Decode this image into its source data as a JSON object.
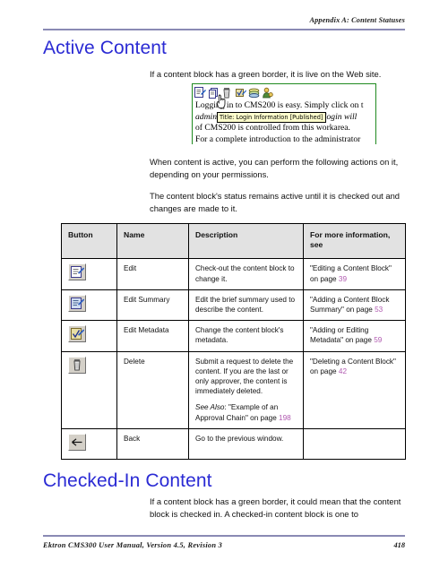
{
  "header": {
    "running_head": "Appendix A: Content Statuses"
  },
  "sections": [
    {
      "heading": "Active Content",
      "intro": "If a content block has a green border, it is live on the Web site."
    },
    {
      "heading": "Checked-In Content",
      "body": "If a content block has a green border, it could mean that the content block is checked in. A checked-in content block is one to"
    }
  ],
  "screenshot": {
    "border_color": "#1f8a1f",
    "toolbar_icons": [
      "edit-icon",
      "edit-summary-icon",
      "delete-icon",
      "edit-metadata-icon",
      "collection-icon",
      "permissions-icon"
    ],
    "tooltip": "Title: Login Information [Published]",
    "lines": [
      "Logging in to CMS200 is easy. Simply click on t",
      "admin and the password admin. This login will",
      "of CMS200 is controlled from this workarea.",
      "For a complete introduction to the administrator"
    ]
  },
  "paragraphs": {
    "when_active": "When content is active, you can perform the following actions on it, depending on your permissions.",
    "status_remains": "The content block's status remains active until it is checked out and changes are made to it."
  },
  "table": {
    "columns": [
      "Button",
      "Name",
      "Description",
      "For more information, see"
    ],
    "rows": [
      {
        "icon": "edit-icon",
        "name": "Edit",
        "description": "Check-out the content block to change it.",
        "see_also": null,
        "reference": "\"Editing a Content Block\" on page",
        "page": "39"
      },
      {
        "icon": "edit-summary-icon",
        "name": "Edit Summary",
        "description": "Edit the brief summary used to describe the content.",
        "see_also": null,
        "reference": "\"Adding a Content Block Summary\" on page",
        "page": "53"
      },
      {
        "icon": "edit-metadata-icon",
        "name": "Edit Metadata",
        "description": "Change the content block's metadata.",
        "see_also": null,
        "reference": "\"Adding or Editing Metadata\" on page",
        "page": "59"
      },
      {
        "icon": "delete-icon",
        "name": "Delete",
        "description": "Submit a request to delete the content. If you are the last or only approver, the content is immediately deleted.",
        "see_also_label": "See Also",
        "see_also": ": \"Example of an Approval Chain\" on page",
        "see_also_page": "198",
        "reference": "\"Deleting a Content Block\" on page",
        "page": "42"
      },
      {
        "icon": "back-icon",
        "name": "Back",
        "description": "Go to the previous window.",
        "see_also": null,
        "reference": "",
        "page": ""
      }
    ]
  },
  "footer": {
    "text": "Ektron CMS300 User Manual, Version 4.5, Revision 3",
    "page_number": "418"
  },
  "colors": {
    "heading": "#2b2bd4",
    "rule": "#8a8ab4",
    "page_link": "#b05ab0",
    "table_header_bg": "#e2e2e2",
    "screenshot_border": "#1f8a1f",
    "tooltip_bg": "#ffffcc"
  }
}
